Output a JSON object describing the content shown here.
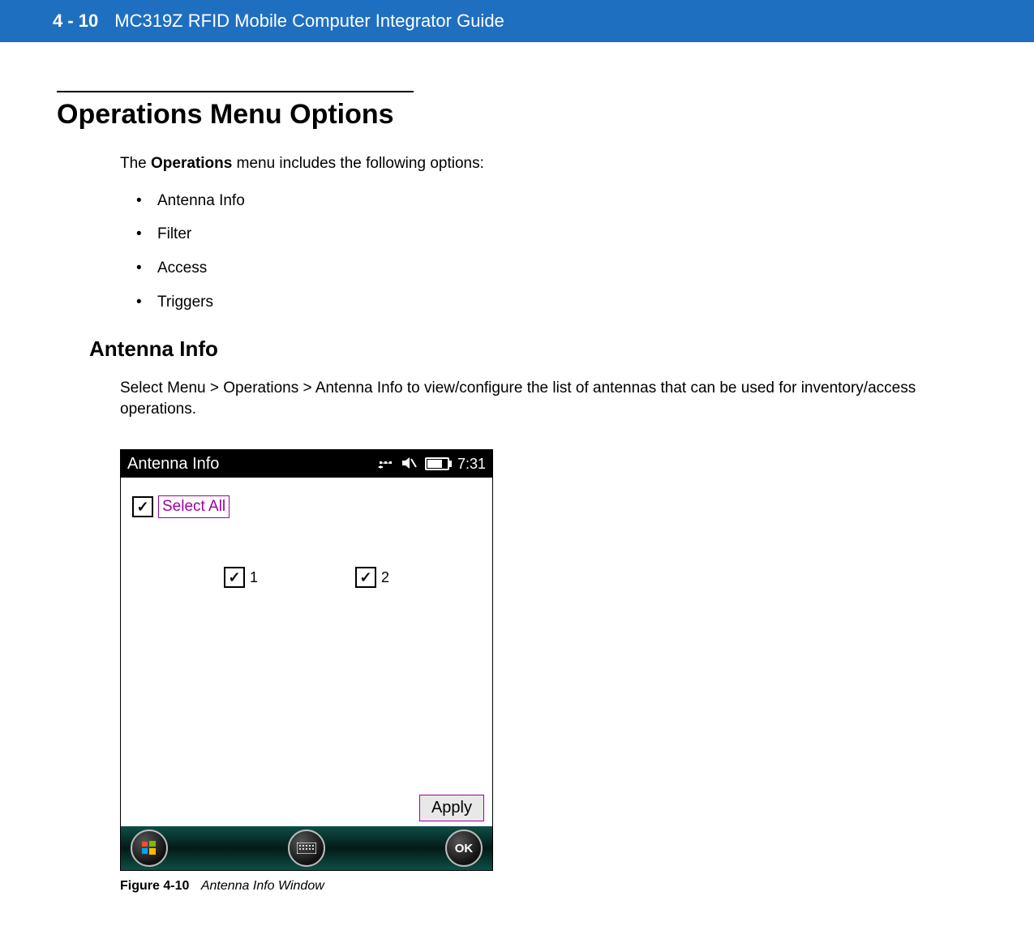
{
  "header": {
    "page_number": "4 - 10",
    "doc_title": "MC319Z RFID Mobile Computer Integrator Guide"
  },
  "section": {
    "heading": "Operations Menu Options",
    "intro_pre": "The ",
    "intro_bold": "Operations",
    "intro_post": " menu includes the following options:",
    "bullets": [
      "Antenna Info",
      "Filter",
      "Access",
      "Triggers"
    ]
  },
  "subsection": {
    "heading": "Antenna Info",
    "text_pre": "Select ",
    "text_bold": "Menu > Operations > Antenna Info",
    "text_post": " to view/configure the list of antennas that can be used for inventory/access operations."
  },
  "device": {
    "title": "Antenna Info",
    "clock": "7:31",
    "select_all_label": "Select All",
    "select_all_checked": true,
    "antennas": [
      {
        "label": "1",
        "checked": true
      },
      {
        "label": "2",
        "checked": true
      }
    ],
    "apply_label": "Apply",
    "ok_label": "OK"
  },
  "figure": {
    "label": "Figure 4-10",
    "title": "Antenna Info Window"
  }
}
